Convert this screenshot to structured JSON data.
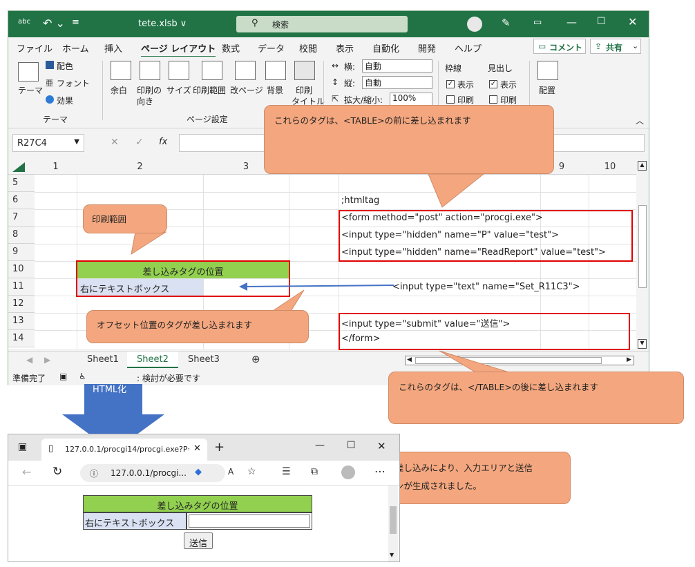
{
  "excel": {
    "autosave_label": "abc",
    "filename": "tete.xlsb ∨",
    "search_placeholder": "検索",
    "menu": [
      "ファイル",
      "ホーム",
      "挿入",
      "ページ レイアウト",
      "数式",
      "データ",
      "校閲",
      "表示",
      "自動化",
      "開発",
      "ヘルプ"
    ],
    "comment_btn": "コメント",
    "share_btn": "共有",
    "ribbon": {
      "theme": "テーマ",
      "colors": "配色",
      "fonts": "フォント",
      "effects": "効果",
      "theme_group": "テーマ",
      "margins": "余白",
      "orientation_1": "印刷の",
      "orientation_2": "向き",
      "size": "サイズ",
      "print_area": "印刷範囲",
      "breaks": "改ページ",
      "background": "背景",
      "print_titles_1": "印刷",
      "print_titles_2": "タイトル",
      "page_setup_group": "ページ設定",
      "width_label": "横:",
      "width_value": "自動",
      "height_label": "縦:",
      "height_value": "自動",
      "scale_label": "拡大/縮小:",
      "scale_value": "100%",
      "gridlines": "枠線",
      "headings": "見出し",
      "view": "表示",
      "print": "印刷",
      "arrange": "配置"
    },
    "namebox": "R27C4",
    "fx": "fx",
    "columns": [
      "1",
      "2",
      "3",
      "",
      "",
      "",
      "",
      "9",
      "10"
    ],
    "rows": [
      "5",
      "6",
      "7",
      "8",
      "9",
      "10",
      "11",
      "12",
      "13",
      "14"
    ],
    "cells": {
      "r6": ";htmltag",
      "r7": "<form method=\"post\" action=\"procgi.exe\">",
      "r8": "<input type=\"hidden\" name=\"P\" value=\"test\">",
      "r9": "<input type=\"hidden\" name=\"ReadReport\" value=\"test\">",
      "r10_header": "差し込みタグの位置",
      "r11_label": "右にテキストボックス",
      "r11_tag": "<input type=\"text\" name=\"Set_R11C3\">",
      "r13": "<input type=\"submit\" value=\"送信\">",
      "r14": "</form>"
    },
    "sheets": [
      "Sheet1",
      "Sheet2",
      "Sheet3"
    ],
    "active_sheet": "Sheet2",
    "status_ready": "準備完了",
    "status_access": ": 検討が必要です"
  },
  "callouts": {
    "before_table": "これらのタグは、<TABLE>の前に差し込まれます",
    "print_area": "印刷範囲",
    "offset": "オフセット位置のタグが差し込まれます",
    "after_table": "これらのタグは、</TABLE>の後に差し込まれます",
    "result_1": "タグ差し込みにより、入力エリアと送信",
    "result_2": "ボタンが生成されました。"
  },
  "arrow_label": "HTML化",
  "browser": {
    "tab_title": "127.0.0.1/procgi14/procgi.exe?P=",
    "address": "127.0.0.1/procgi...",
    "table_header": "差し込みタグの位置",
    "row_label": "右にテキストボックス",
    "submit": "送信"
  },
  "colors": {
    "excel_green": "#217346",
    "cell_header_green": "#92d050",
    "callout": "#f4a77f",
    "arrow_blue": "#4472c4",
    "border_red": "#e00000"
  }
}
